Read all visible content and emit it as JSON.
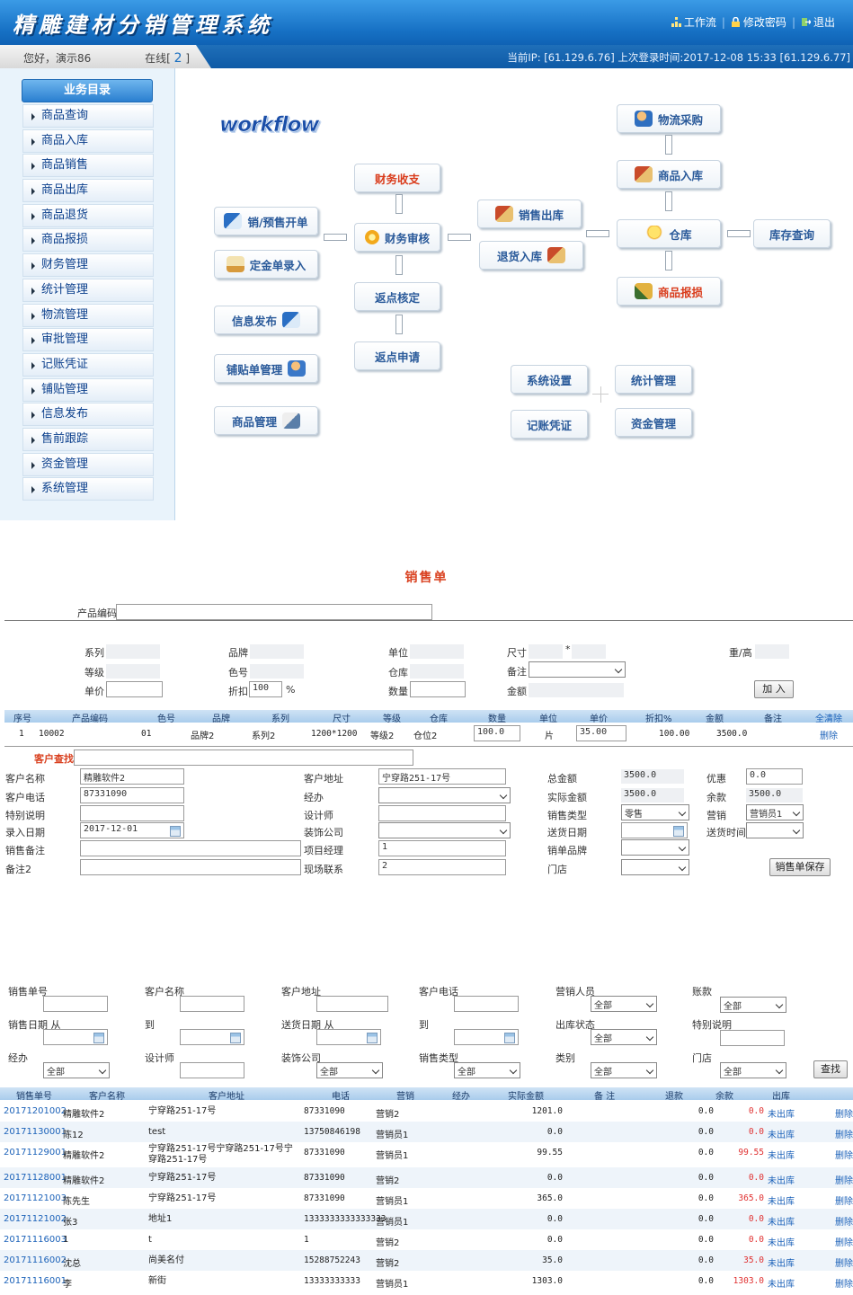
{
  "header": {
    "title": "精雕建材分销管理系统",
    "links": [
      {
        "label": "工作流",
        "icon": "org-chart-icon"
      },
      {
        "label": "修改密码",
        "icon": "lock-icon"
      },
      {
        "label": "退出",
        "icon": "exit-icon"
      }
    ]
  },
  "status": {
    "greeting": "您好，演示86",
    "online_label": "在线[",
    "online_count": "2",
    "online_close": "]",
    "login_info": "当前IP: [61.129.6.76] 上次登录时间:2017-12-08 15:33 [61.129.6.77]"
  },
  "sidebar": {
    "title": "业务目录",
    "items": [
      "商品查询",
      "商品入库",
      "商品销售",
      "商品出库",
      "商品退货",
      "商品报损",
      "财务管理",
      "统计管理",
      "物流管理",
      "审批管理",
      "记账凭证",
      "铺贴管理",
      "信息发布",
      "售前跟踪",
      "资金管理",
      "系统管理"
    ]
  },
  "workflow": {
    "title": "workflow",
    "nodes": {
      "wuliu": "物流采购",
      "rukuj": "商品入库",
      "cangku": "仓库",
      "kucun": "库存查询",
      "baosun": "商品报损",
      "xiaoshouck": "销售出库",
      "tuihuo": "退货入库",
      "caiwush": "财务审核",
      "caiwusz": "财务收支",
      "fandianhd": "返点核定",
      "fandiansq": "返点申请",
      "xiaoshou": "销/预售开单",
      "dingjin": "定金单录入",
      "xinxi": "信息发布",
      "putie": "铺贴单管理",
      "shangpin": "商品管理",
      "xitong": "系统设置",
      "tongji": "统计管理",
      "jizhang": "记账凭证",
      "zijin": "资金管理"
    }
  },
  "sales": {
    "title": "销售单",
    "product_code_label": "产品编码",
    "fields": {
      "xilie": "系列",
      "pinpai": "品牌",
      "danwei": "单位",
      "chicun": "尺寸",
      "chicun_sep": "*",
      "zhonggao": "重/高",
      "dengji": "等级",
      "sehao": "色号",
      "cangku": "仓库",
      "beizhu": "备注",
      "danjia": "单价",
      "zhekou": "折扣",
      "zhekou_val": "100",
      "percent": "%",
      "shuliang": "数量",
      "jine": "金额"
    },
    "add_btn": "加 入",
    "item_headers": [
      "序号",
      "产品编码",
      "色号",
      "品牌",
      "系列",
      "尺寸",
      "等级",
      "仓库",
      "数量",
      "单位",
      "单价",
      "折扣%",
      "金额",
      "备注",
      "全清除"
    ],
    "item_row": {
      "seq": "1",
      "code": "10002",
      "color": "01",
      "brand": "品牌2",
      "series": "系列2",
      "size": "1200*1200",
      "grade": "等级2",
      "wh": "仓位2",
      "qty": "100.0",
      "unit": "片",
      "price": "35.00",
      "discount": "100.00",
      "amount": "3500.0",
      "remark": "",
      "del": "删除"
    },
    "cust_search": "客户查找",
    "cust": {
      "name_l": "客户名称",
      "name": "精雕软件2",
      "tel_l": "客户电话",
      "tel": "87331090",
      "note_l": "特别说明",
      "date_l": "录入日期",
      "date": "2017-12-01",
      "sale_note_l": "销售备注",
      "note2_l": "备注2",
      "addr_l": "客户地址",
      "addr": "宁穿路251-17号",
      "jingban_l": "经办",
      "designer_l": "设计师",
      "deco_l": "装饰公司",
      "pm_l": "项目经理",
      "pm": "1",
      "site_l": "现场联系",
      "site": "2",
      "total_l": "总金额",
      "total": "3500.0",
      "actual_l": "实际金额",
      "actual": "3500.0",
      "type_l": "销售类型",
      "type": "零售",
      "deliv_l": "送货日期",
      "brand_l": "销单品牌",
      "store_l": "门店",
      "youhui_l": "优惠",
      "youhui": "0.0",
      "yue_l": "余款",
      "yue": "3500.0",
      "yingxiao_l": "营销",
      "yingxiao": "营销员1",
      "deliv_time_l": "送货时间"
    },
    "save_btn": "销售单保存"
  },
  "search": {
    "labels": {
      "no": "销售单号",
      "cname": "客户名称",
      "caddr": "客户地址",
      "ctel": "客户电话",
      "sales": "营销人员",
      "acct": "账款",
      "date": "销售日期 从",
      "to": "到",
      "deliv": "送货日期 从",
      "to2": "到",
      "out": "出库状态",
      "note": "特别说明",
      "jb": "经办",
      "des": "设计师",
      "deco": "装饰公司",
      "type": "销售类型",
      "cat": "类别",
      "store": "门店"
    },
    "all": "全部",
    "btn": "查找"
  },
  "list": {
    "headers": [
      "销售单号",
      "客户名称",
      "客户地址",
      "电话",
      "营销",
      "经办",
      "实际金额",
      "备 注",
      "退款",
      "余款",
      "出库",
      ""
    ],
    "rows": [
      [
        "20171201002",
        "精雕软件2",
        "宁穿路251-17号",
        "87331090",
        "营销2",
        "",
        "1201.0",
        "",
        "0.0",
        "0.0",
        "未出库",
        "删除"
      ],
      [
        "20171130001",
        "陈12",
        "test",
        "13750846198",
        "营销员1",
        "",
        "0.0",
        "",
        "0.0",
        "0.0",
        "未出库",
        "删除"
      ],
      [
        "20171129001",
        "精雕软件2",
        "宁穿路251-17号宁穿路251-17号宁穿路251-17号",
        "87331090",
        "营销员1",
        "",
        "99.55",
        "",
        "0.0",
        "99.55",
        "未出库",
        "删除"
      ],
      [
        "20171128001",
        "精雕软件2",
        "宁穿路251-17号",
        "87331090",
        "营销2",
        "",
        "0.0",
        "",
        "0.0",
        "0.0",
        "未出库",
        "删除"
      ],
      [
        "20171121003",
        "陈先生",
        "宁穿路251-17号",
        "87331090",
        "营销员1",
        "",
        "365.0",
        "",
        "0.0",
        "365.0",
        "未出库",
        "删除"
      ],
      [
        "20171121002",
        "张3",
        "地址1",
        "1333333333333333",
        "营销员1",
        "",
        "0.0",
        "",
        "0.0",
        "0.0",
        "未出库",
        "删除"
      ],
      [
        "20171116003",
        "1",
        "t",
        "1",
        "营销2",
        "",
        "0.0",
        "",
        "0.0",
        "0.0",
        "未出库",
        "删除"
      ],
      [
        "20171116002",
        "沈总",
        "尚美名付",
        "15288752243",
        "营销2",
        "",
        "35.0",
        "",
        "0.0",
        "35.0",
        "未出库",
        "删除"
      ],
      [
        "20171116001",
        "李",
        "新街",
        "13333333333",
        "营销员1",
        "",
        "1303.0",
        "",
        "0.0",
        "1303.0",
        "未出库",
        "删除"
      ]
    ]
  }
}
